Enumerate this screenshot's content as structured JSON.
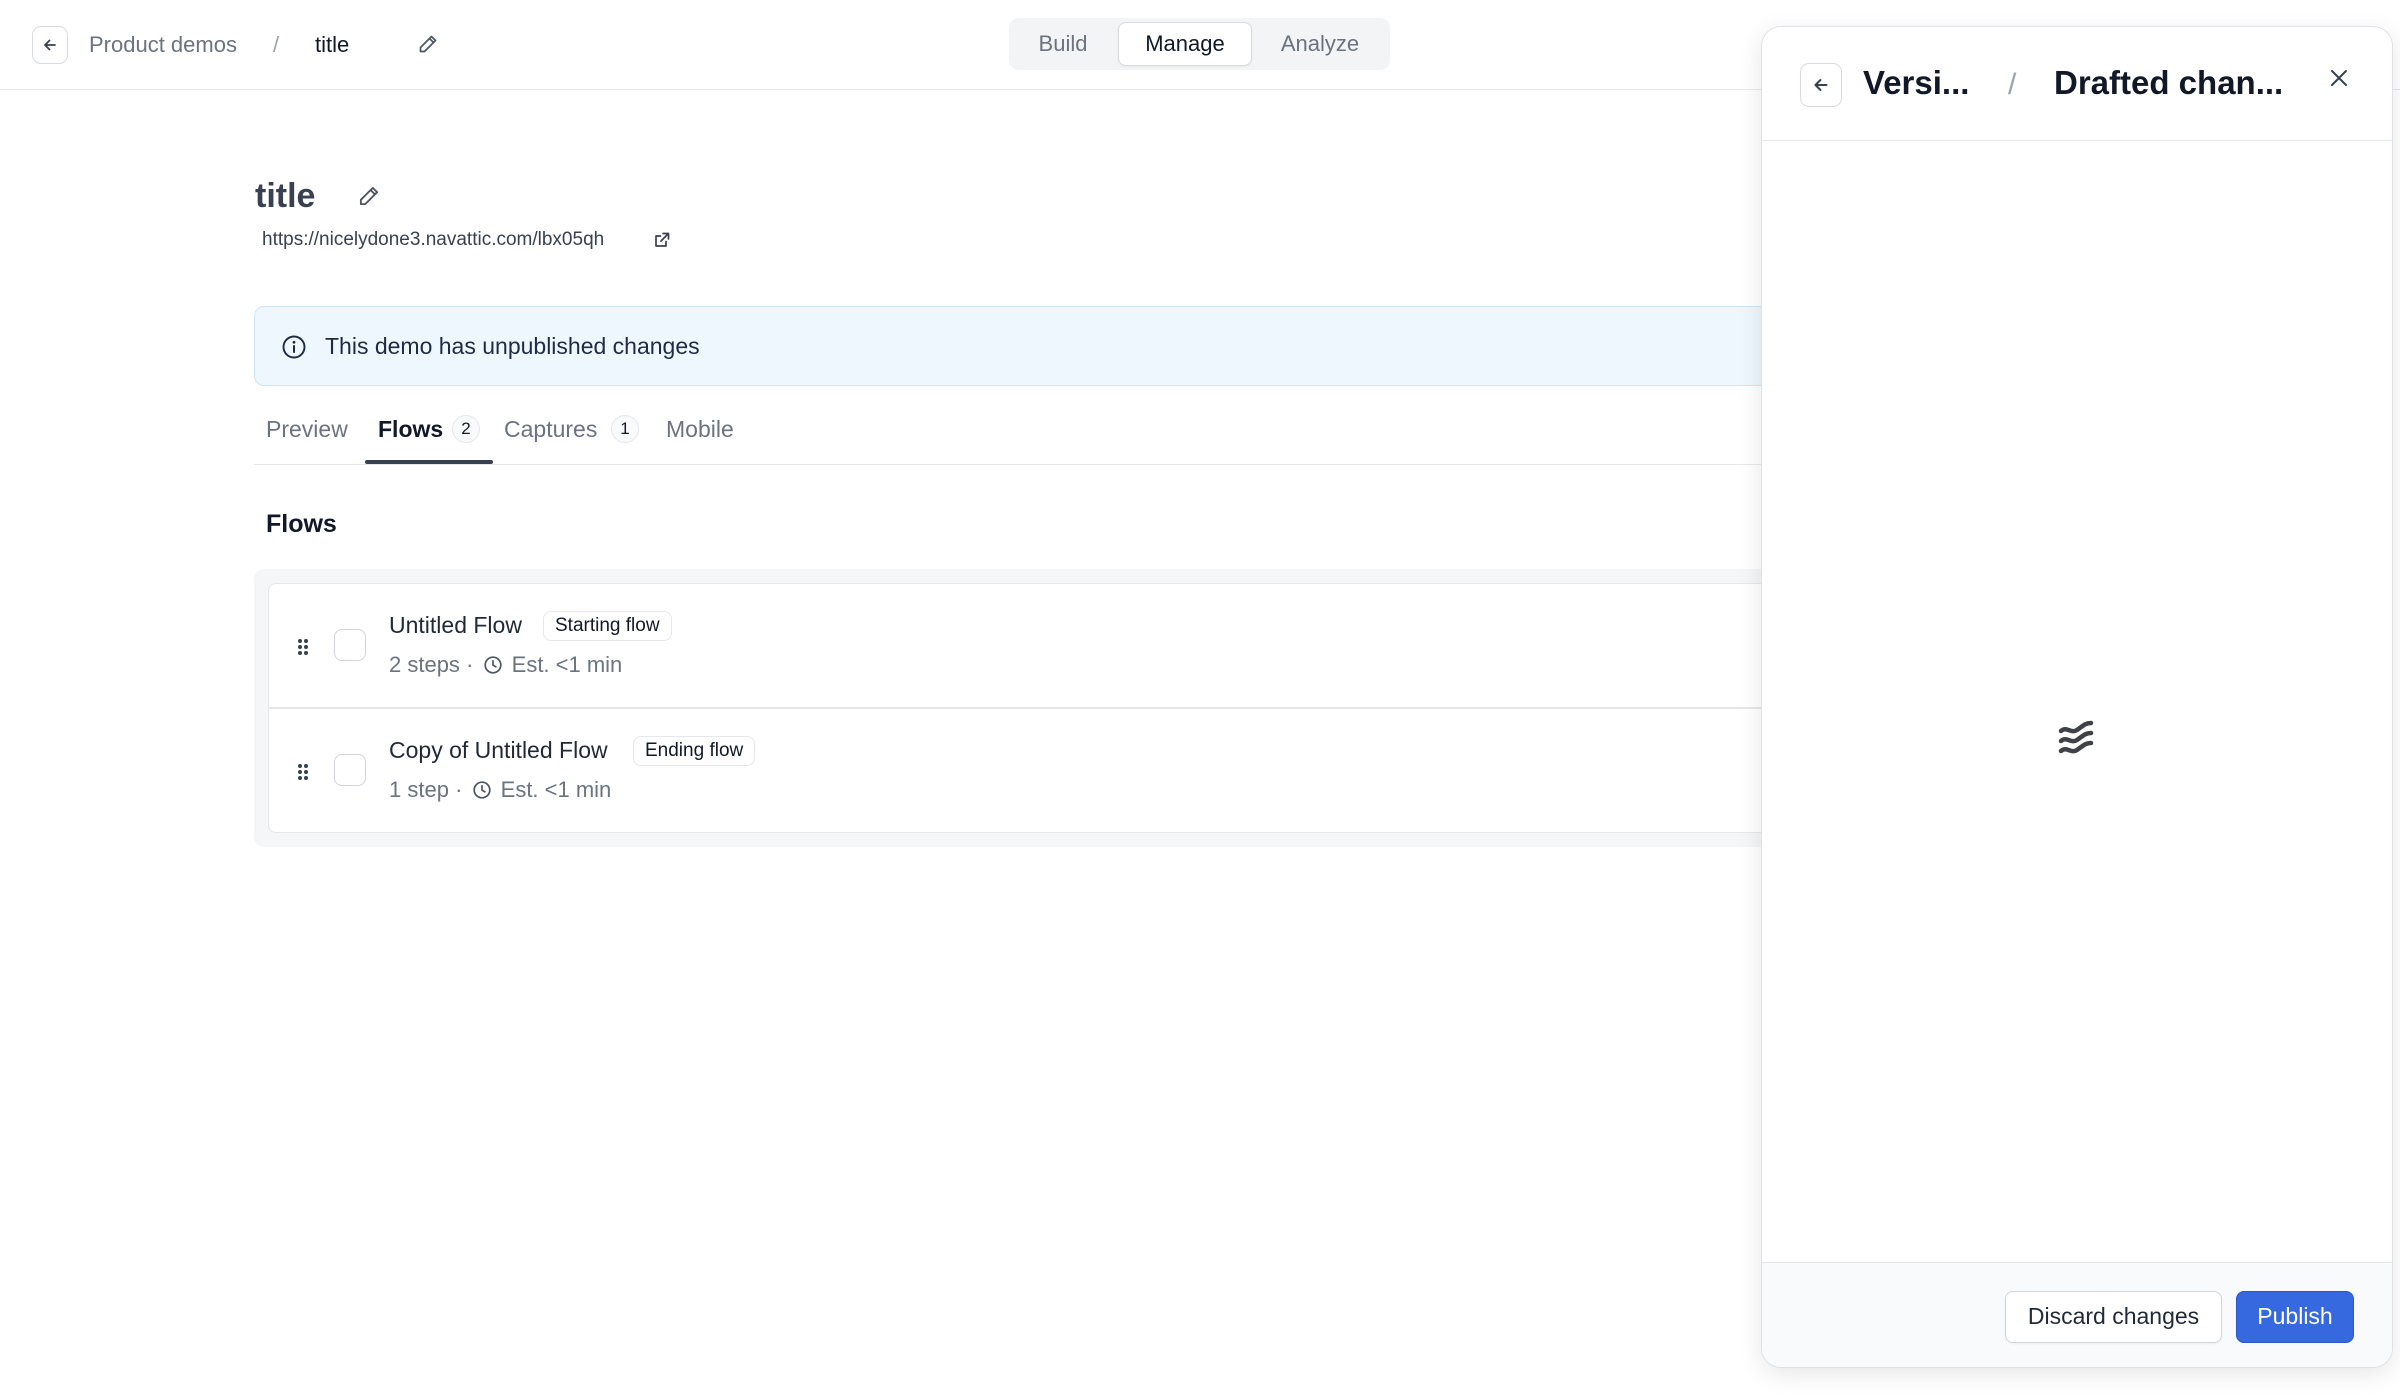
{
  "header": {
    "breadcrumb_parent": "Product demos",
    "breadcrumb_separator": "/",
    "breadcrumb_current": "title",
    "modes": [
      "Build",
      "Manage",
      "Analyze"
    ],
    "active_mode": "Manage"
  },
  "demo": {
    "title": "title",
    "url": "https://nicelydone3.navattic.com/lbx05qh",
    "banner_text": "This demo has unpublished changes"
  },
  "tabs": [
    {
      "label": "Preview",
      "count": ""
    },
    {
      "label": "Flows",
      "count": "2"
    },
    {
      "label": "Captures",
      "count": "1"
    },
    {
      "label": "Mobile",
      "count": ""
    }
  ],
  "active_tab": "Flows",
  "flows_section": {
    "title": "Flows",
    "items": [
      {
        "name": "Untitled Flow",
        "badge": "Starting flow",
        "steps": "2 steps",
        "separator": "·",
        "duration": "Est. <1 min"
      },
      {
        "name": "Copy of Untitled Flow",
        "badge": "Ending flow",
        "steps": "1 step",
        "separator": "·",
        "duration": "Est. <1 min"
      }
    ]
  },
  "panel": {
    "crumb_parent": "Versi...",
    "crumb_separator": "/",
    "crumb_current": "Drafted chan...",
    "discard_label": "Discard changes",
    "publish_label": "Publish"
  },
  "colors": {
    "accent": "#3668e0",
    "banner_bg": "#eef7fe",
    "banner_border": "#cbe6fb",
    "active_tab_underline": "#374151"
  },
  "icons": [
    "back-arrow-icon",
    "pencil-icon",
    "external-link-icon",
    "info-icon",
    "drag-handle-icon",
    "clock-icon",
    "close-icon",
    "loading-icon"
  ]
}
